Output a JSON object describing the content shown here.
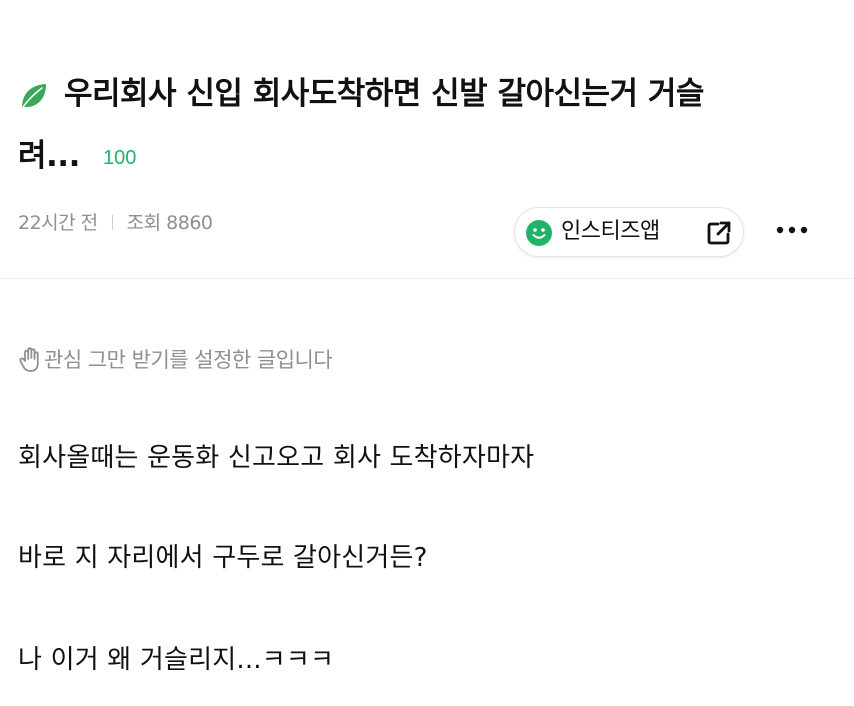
{
  "post": {
    "title_line1": "우리회사 신입 회사도착하면 신발 갈아신는거 거슬",
    "title_line2": "려...",
    "comment_count": "100",
    "time_ago": "22시간 전",
    "views": "조회 8860",
    "app_button_label": "인스티즈앱",
    "notice": "관심 그만 받기를 설정한 글입니다",
    "body": [
      "회사올때는 운동화 신고오고 회사 도착하자마자",
      "바로 지 자리에서 구두로 갈아신거든?",
      "나 이거 왜 거슬리지...ㅋㅋㅋ"
    ]
  },
  "icons": {
    "title_icon": "leaf-icon",
    "app_icon": "smile-icon",
    "share_icon": "external-link-icon",
    "more_icon": "more-dots-icon",
    "notice_icon": "hand-icon"
  },
  "colors": {
    "accent_green": "#22b36a",
    "leaf_green": "#3aa85a",
    "meta_gray": "#8f8f8f",
    "text": "#111111"
  }
}
